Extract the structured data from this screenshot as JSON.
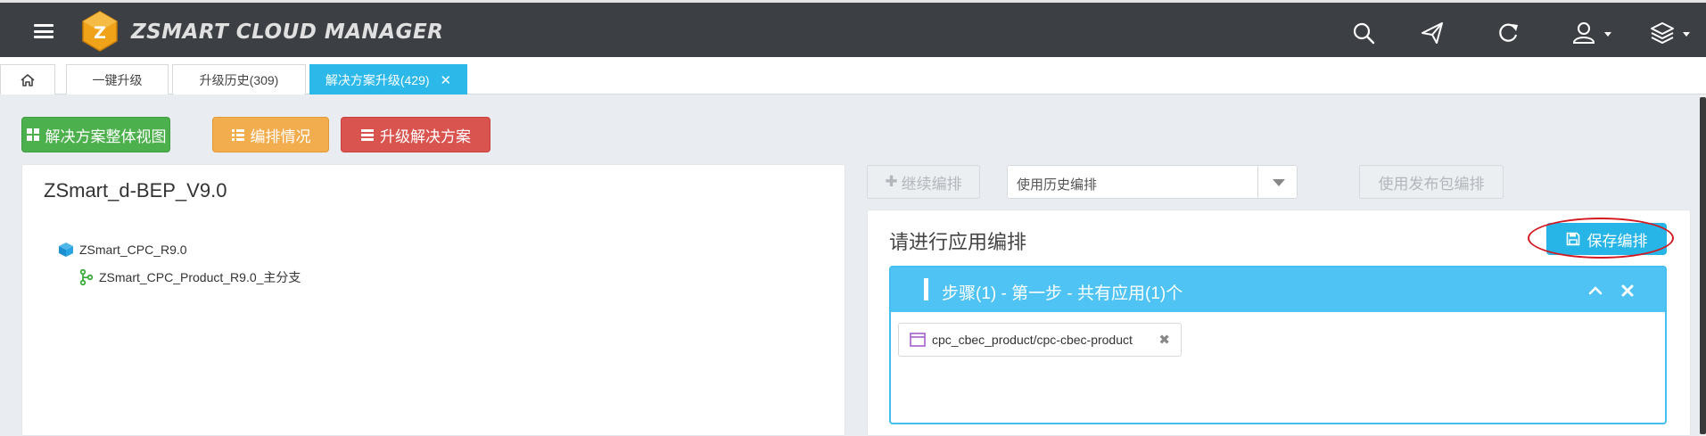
{
  "app": {
    "brand": "ZSMART CLOUD MANAGER",
    "logo_letter": "Z"
  },
  "header_icons": [
    "menu-icon",
    "search-icon",
    "send-icon",
    "refresh-icon",
    "user-icon",
    "layers-icon"
  ],
  "tabs": [
    {
      "label": "",
      "icon": "home-icon"
    },
    {
      "label": "一键升级"
    },
    {
      "label": "升级历史(309)"
    },
    {
      "label": "解决方案升级(429)",
      "active": true,
      "close": "✕"
    }
  ],
  "actions": {
    "overview_label": "解决方案整体视图",
    "orchestration_label": "编排情况",
    "upgrade_label": "升级解决方案"
  },
  "left": {
    "title": "ZSmart_d-BEP_V9.0",
    "tree": [
      {
        "label": "ZSmart_CPC_R9.0",
        "icon": "cube-icon"
      },
      {
        "label": "ZSmart_CPC_Product_R9.0_主分支",
        "icon": "branch-icon"
      }
    ]
  },
  "toolbar": {
    "continue_label": "继续编排",
    "history_placeholder": "使用历史编排",
    "publish_label": "使用发布包编排"
  },
  "right": {
    "title": "请进行应用编排",
    "save_label": "保存编排",
    "step": {
      "title": "步骤(1) - 第一步 - 共有应用(1)个",
      "apps": [
        {
          "label": "cpc_cbec_product/cpc-cbec-product",
          "remove": "✖"
        }
      ]
    }
  },
  "colors": {
    "header_bg": "#3c3f44",
    "active_tab": "#2cb8e8",
    "green": "#4cb04d",
    "orange": "#f2ad4e",
    "red": "#d9534f",
    "step_header": "#4fc3f3",
    "highlight_ring": "#d4181f"
  }
}
